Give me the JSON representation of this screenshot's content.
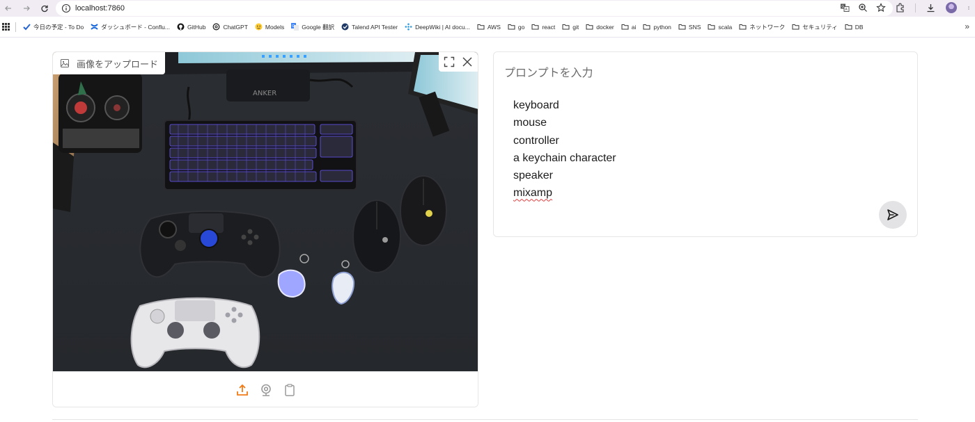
{
  "browser": {
    "url": "localhost:7860",
    "bookmarks": [
      {
        "label": "今日の予定 - To Do",
        "icon": "todo-check-icon"
      },
      {
        "label": "ダッシュボード - Conflu...",
        "icon": "confluence-icon"
      },
      {
        "label": "GitHub",
        "icon": "github-icon"
      },
      {
        "label": "ChatGPT",
        "icon": "chatgpt-icon"
      },
      {
        "label": "Models",
        "icon": "huggingface-icon"
      },
      {
        "label": "Google 翻訳",
        "icon": "google-translate-icon"
      },
      {
        "label": "Talend API Tester",
        "icon": "talend-icon"
      },
      {
        "label": "DeepWiki | AI docu...",
        "icon": "deepwiki-icon"
      },
      {
        "label": "AWS",
        "icon": "folder-icon"
      },
      {
        "label": "go",
        "icon": "folder-icon"
      },
      {
        "label": "react",
        "icon": "folder-icon"
      },
      {
        "label": "git",
        "icon": "folder-icon"
      },
      {
        "label": "docker",
        "icon": "folder-icon"
      },
      {
        "label": "ai",
        "icon": "folder-icon"
      },
      {
        "label": "python",
        "icon": "folder-icon"
      },
      {
        "label": "SNS",
        "icon": "folder-icon"
      },
      {
        "label": "scala",
        "icon": "folder-icon"
      },
      {
        "label": "ネットワーク",
        "icon": "folder-icon"
      },
      {
        "label": "セキュリティ",
        "icon": "folder-icon"
      },
      {
        "label": "DB",
        "icon": "folder-icon"
      }
    ],
    "more": "»"
  },
  "image_panel": {
    "label": "画像をアップロード",
    "monitor_brand": "ANKER"
  },
  "prompt_panel": {
    "label": "プロンプトを入力",
    "lines": [
      "keyboard",
      "mouse",
      "controller",
      "a keychain character",
      "speaker",
      "mixamp"
    ]
  },
  "colors": {
    "accent_orange": "#f07b17",
    "chrome_bg": "#f1ecf4",
    "send_bg": "#e3e3e5"
  }
}
